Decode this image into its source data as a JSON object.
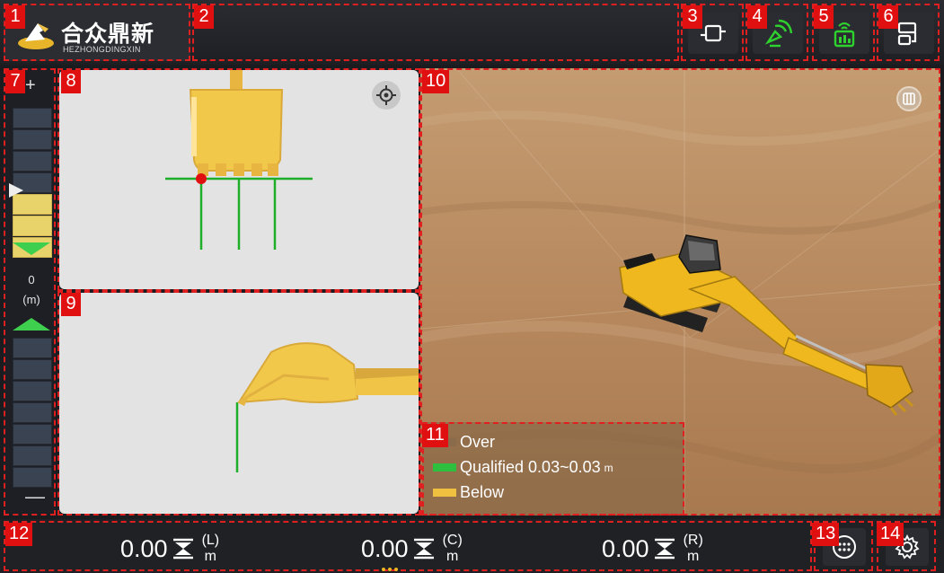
{
  "header": {
    "logo_cn": "合众鼎新",
    "logo_en": "HEZHONGDINGXIN",
    "title": ""
  },
  "toolbar": {
    "buttons": [
      {
        "badge": "3",
        "icon": "connection-icon",
        "color": "#ffffff"
      },
      {
        "badge": "4",
        "icon": "satellite-icon",
        "color": "#2fd12f"
      },
      {
        "badge": "5",
        "icon": "radio-signal-icon",
        "color": "#2fd12f"
      },
      {
        "badge": "6",
        "icon": "device-switch-icon",
        "color": "#ffffff"
      }
    ]
  },
  "badges": {
    "logo": "1",
    "title": "2",
    "scale": "7",
    "front_view": "8",
    "side_view": "9",
    "view_3d": "10",
    "legend": "11",
    "bottom": "12",
    "menu": "13",
    "settings": "14"
  },
  "scale": {
    "plus": "+",
    "minus": "—",
    "value": "0",
    "unit": "(m)"
  },
  "legend": {
    "over": "Over",
    "qualified": "Qualified 0.03~0.03",
    "qualified_unit": "m",
    "below": "Below",
    "colors": {
      "over": "#8a6b4b",
      "qualified": "#2fbf3f",
      "below": "#f0c040"
    }
  },
  "readouts": [
    {
      "value": "0.00",
      "position": "(L)",
      "unit": "m"
    },
    {
      "value": "0.00",
      "position": "(C)",
      "unit": "m"
    },
    {
      "value": "0.00",
      "position": "(R)",
      "unit": "m"
    }
  ],
  "colors": {
    "accent_red": "#e01010",
    "guide_green": "#1fae2a",
    "bucket_yellow": "#f2c84b"
  }
}
